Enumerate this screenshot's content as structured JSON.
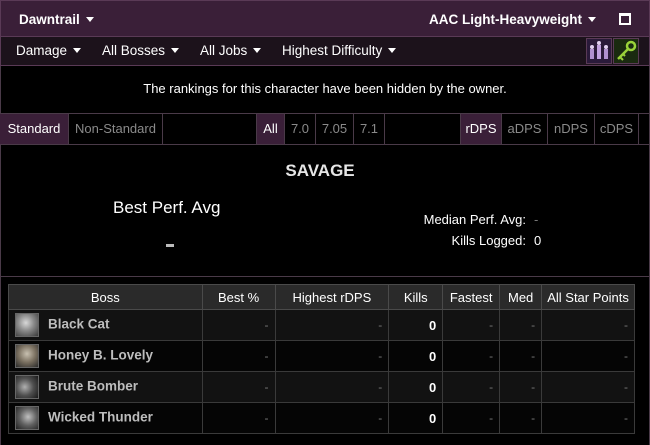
{
  "header": {
    "expansion": "Dawntrail",
    "zone": "AAC Light-Heavyweight"
  },
  "filters": {
    "metric": "Damage",
    "bosses": "All Bosses",
    "jobs": "All Jobs",
    "difficulty": "Highest Difficulty"
  },
  "icons": {
    "crowns": "crowns-icon",
    "key": "key-icon"
  },
  "message": "The rankings for this character have been hidden by the owner.",
  "tabs": {
    "standard": "Standard",
    "non_standard": "Non-Standard",
    "all": "All",
    "v70": "7.0",
    "v705": "7.05",
    "v71": "7.1",
    "rdps": "rDPS",
    "adps": "aDPS",
    "ndps": "nDPS",
    "cdps": "cDPS"
  },
  "summary": {
    "title": "SAVAGE",
    "best_perf_label": "Best Perf. Avg",
    "median_label": "Median Perf. Avg:",
    "median_value": "-",
    "kills_label": "Kills Logged:",
    "kills_value": "0"
  },
  "table": {
    "headers": [
      "Boss",
      "Best %",
      "Highest rDPS",
      "Kills",
      "Fastest",
      "Med",
      "All Star Points"
    ],
    "rows": [
      {
        "boss": "Black Cat",
        "best": "-",
        "highest": "-",
        "kills": "0",
        "fastest": "-",
        "med": "-",
        "allstar": "-"
      },
      {
        "boss": "Honey B. Lovely",
        "best": "-",
        "highest": "-",
        "kills": "0",
        "fastest": "-",
        "med": "-",
        "allstar": "-"
      },
      {
        "boss": "Brute Bomber",
        "best": "-",
        "highest": "-",
        "kills": "0",
        "fastest": "-",
        "med": "-",
        "allstar": "-"
      },
      {
        "boss": "Wicked Thunder",
        "best": "-",
        "highest": "-",
        "kills": "0",
        "fastest": "-",
        "med": "-",
        "allstar": "-"
      }
    ]
  },
  "colors": {
    "accent": "#3a1f38",
    "border": "#5a3a56"
  }
}
